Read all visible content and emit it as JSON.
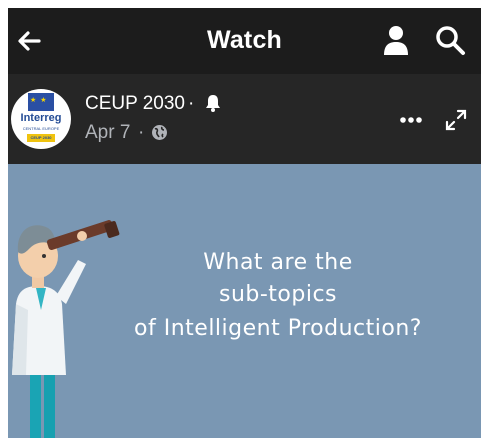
{
  "appbar": {
    "title": "Watch",
    "back_icon": "arrow-left-icon",
    "profile_icon": "user-icon",
    "search_icon": "search-icon"
  },
  "post": {
    "page_name": "CEUP 2030",
    "separator": "·",
    "notification_icon": "bell-icon",
    "date": "Apr 7",
    "privacy_icon": "globe-icon",
    "avatar": {
      "brand": "Interreg",
      "subtitle": "CENTRAL EUROPE",
      "tag": "CEUP 2030"
    },
    "more_icon": "more-horizontal-icon",
    "expand_icon": "expand-icon"
  },
  "video": {
    "caption_line1": "What are the",
    "caption_line2": "sub-topics",
    "caption_line3": "of Intelligent Production?",
    "background_color": "#7a97b3"
  },
  "colors": {
    "appbar_bg": "#1c1c1c",
    "header_bg": "#262626",
    "secondary_text": "#b0b3b8"
  }
}
